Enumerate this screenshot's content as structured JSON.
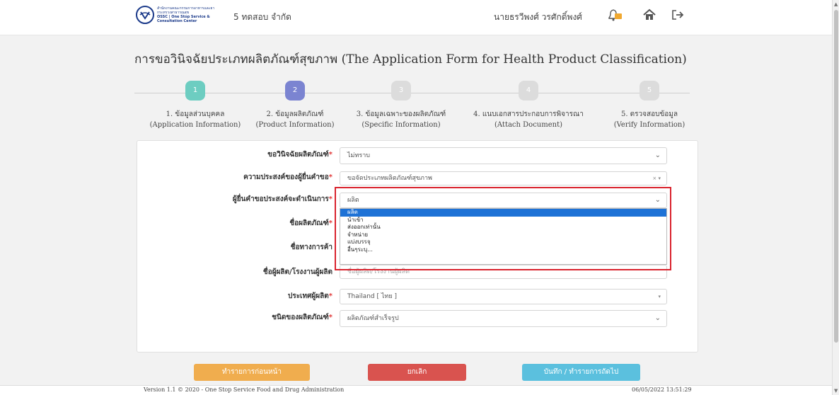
{
  "header": {
    "logo_line1": "สำนักงานคณะกรรมการอาหารและยา",
    "logo_line2": "กระทรวงสาธารณสุข",
    "logo_line3": "OSSC | One Stop Service & Consultation Center",
    "company": "5 ทดสอบ จำกัด",
    "username": "นายธรวีพงศ์ วรศักดิ์พงศ์"
  },
  "title": "การขอวินิจฉัยประเภทผลิตภัณฑ์สุขภาพ (The Application Form for Health Product Classification)",
  "stepper": [
    {
      "num": "1",
      "label": "1. ข้อมูลส่วนบุคคล",
      "label_en": "(Application Information)",
      "color": "#6dcdc1"
    },
    {
      "num": "2",
      "label": "2. ข้อมูลผลิตภัณฑ์",
      "label_en": "(Product Information)",
      "color": "#7b84d1"
    },
    {
      "num": "3",
      "label": "3. ข้อมูลเฉพาะของผลิตภัณฑ์",
      "label_en": "(Specific Information)",
      "color": "#dcdcdc"
    },
    {
      "num": "4",
      "label": "4. แนบเอกสารประกอบการพิจารณา",
      "label_en": "(Attach Document)",
      "color": "#dcdcdc"
    },
    {
      "num": "5",
      "label": "5. ตรวจสอบข้อมูล",
      "label_en": "(Verify Information)",
      "color": "#dcdcdc"
    }
  ],
  "form": {
    "f1_label": "ขอวินิจฉัยผลิตภัณฑ์",
    "f1_value": "ไม่ทราบ",
    "f2_label": "ความประสงค์ของผู้ยื่นคำขอ",
    "f2_value": "ขอจัดประเภทผลิตภัณฑ์สุขภาพ",
    "f3_label": "ผู้ยื่นคำขอประสงค์จะดำเนินการ",
    "f3_value": "ผลิต",
    "f4_label": "ชื่อผลิตภัณฑ์",
    "f5_label": "ชื่อทางการค้า",
    "f6_label": "ชื่อผู้ผลิต/โรงงานผู้ผลิต",
    "f6_placeholder": "ชื่อผู้ผลิต/โรงงานผู้ผลิต",
    "f7_label": "ประเทศผู้ผลิต",
    "f7_value": "Thailand [ ไทย ]",
    "f8_label": "ชนิดของผลิตภัณฑ์",
    "f8_value": "ผลิตภัณฑ์สำเร็จรูป",
    "required_mark": "*",
    "clear_mark": "× ▾"
  },
  "dropdown_options": [
    "ผลิต",
    "นำเข้า",
    "ส่งออกเท่านั้น",
    "จำหน่าย",
    "แบ่งบรรจุ",
    "อื่นๆระบุ..."
  ],
  "buttons": {
    "prev": "ทำรายการก่อนหน้า",
    "cancel": "ยกเลิก",
    "save": "บันทึก / ทำรายการถัดไป"
  },
  "footer": {
    "version": "Version 1.1 © 2020 - One Stop Service Food and Drug Administration",
    "timestamp": "06/05/2022 13:51:29"
  }
}
